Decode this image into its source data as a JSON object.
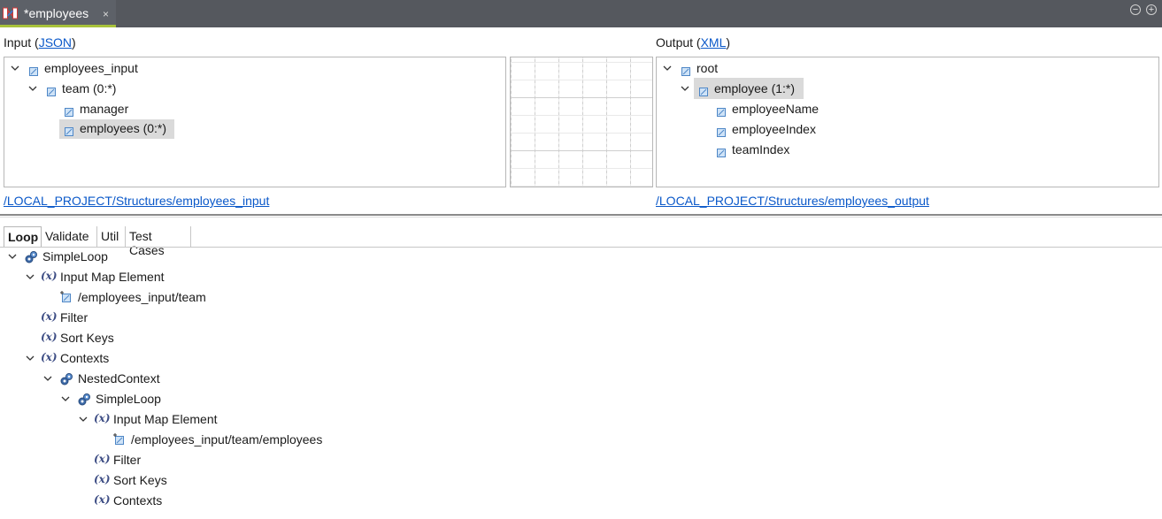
{
  "editor": {
    "tab_title": "*employees",
    "close_glyph": "×",
    "minimize_glyph": "−",
    "maximize_glyph": "+"
  },
  "input": {
    "label_prefix": "Input (",
    "format": "JSON",
    "label_suffix": ")",
    "path": "/LOCAL_PROJECT/Structures/employees_input",
    "tree": [
      "employees_input",
      "team (0:*)",
      "manager",
      "employees (0:*)"
    ]
  },
  "output": {
    "label_prefix": "Output (",
    "format": "XML",
    "label_suffix": ")",
    "path": "/LOCAL_PROJECT/Structures/employees_output",
    "tree": [
      "root",
      "employee (1:*)",
      "employeeName",
      "employeeIndex",
      "teamIndex"
    ]
  },
  "tabs": [
    "Loop",
    "Validate",
    "Util",
    "Test Cases"
  ],
  "loop_tree": [
    "SimpleLoop",
    "Input Map Element",
    "/employees_input/team",
    "Filter",
    "Sort Keys",
    "Contexts",
    "NestedContext",
    "SimpleLoop",
    "Input Map Element",
    "/employees_input/team/employees",
    "Filter",
    "Sort Keys",
    "Contexts"
  ],
  "icons": {
    "element": "element-box-icon",
    "variable": "variable-x-icon",
    "loop": "gear-loop-icon",
    "mapping": "mapping-file-icon"
  },
  "colors": {
    "titlebar": "#55585e",
    "active_tab_underline": "#a8c23a",
    "link": "#0a58c9",
    "selection": "#dadada"
  }
}
